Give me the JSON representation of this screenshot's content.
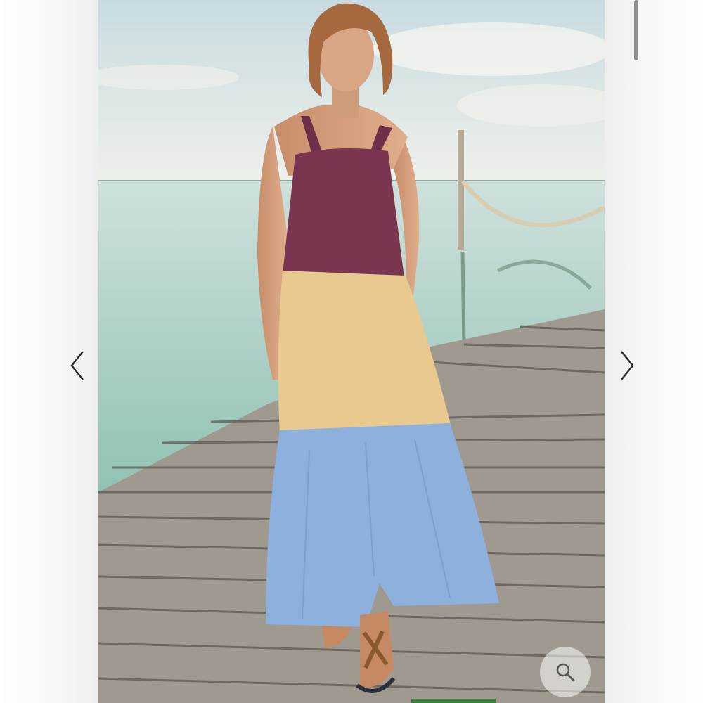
{
  "gallery": {
    "photo_alt": "",
    "prev_icon": "chevron-left-icon",
    "next_icon": "chevron-right-icon",
    "zoom_icon": "magnifier-icon"
  },
  "colors": {
    "dress_top": "#7a3550",
    "dress_middle": "#e8c98f",
    "dress_bottom": "#8eb0dd",
    "water": "#a9cbbf",
    "sky": "#dfe7e6",
    "dock": "#9d978e",
    "arrow": "#2b2b2b",
    "scrollbar": "#8d8d8d"
  }
}
